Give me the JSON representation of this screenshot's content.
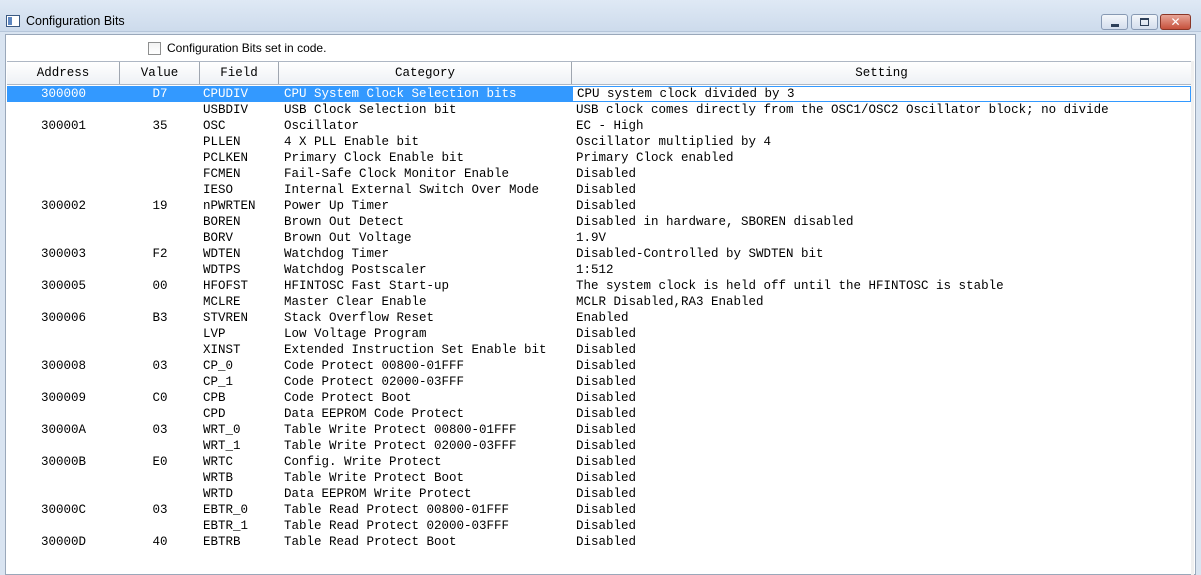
{
  "window": {
    "title": "Configuration Bits",
    "minimize_icon": "minimize-icon",
    "maximize_icon": "maximize-icon",
    "close_icon": "close-icon"
  },
  "options": {
    "checkbox_label": "Configuration Bits set in code.",
    "checked": false
  },
  "table": {
    "headers": [
      "Address",
      "Value",
      "Field",
      "Category",
      "Setting"
    ],
    "selected_row": 0,
    "rows": [
      {
        "address": "300000",
        "value": "D7",
        "field": "CPUDIV",
        "category": "CPU System Clock Selection bits",
        "setting": "CPU system clock divided by 3"
      },
      {
        "address": "",
        "value": "",
        "field": "USBDIV",
        "category": "USB Clock Selection bit",
        "setting": "USB clock comes directly from the OSC1/OSC2 Oscillator block; no divide"
      },
      {
        "address": "300001",
        "value": "35",
        "field": "OSC",
        "category": "Oscillator",
        "setting": "EC - High"
      },
      {
        "address": "",
        "value": "",
        "field": "PLLEN",
        "category": "4 X PLL Enable bit",
        "setting": "Oscillator multiplied by 4"
      },
      {
        "address": "",
        "value": "",
        "field": "PCLKEN",
        "category": "Primary Clock Enable bit",
        "setting": "Primary Clock enabled"
      },
      {
        "address": "",
        "value": "",
        "field": "FCMEN",
        "category": "Fail-Safe Clock Monitor Enable",
        "setting": "Disabled"
      },
      {
        "address": "",
        "value": "",
        "field": "IESO",
        "category": "Internal External Switch Over Mode",
        "setting": "Disabled"
      },
      {
        "address": "300002",
        "value": "19",
        "field": "nPWRTEN",
        "category": "Power Up Timer",
        "setting": "Disabled"
      },
      {
        "address": "",
        "value": "",
        "field": "BOREN",
        "category": "Brown Out Detect",
        "setting": "Disabled in hardware, SBOREN disabled"
      },
      {
        "address": "",
        "value": "",
        "field": "BORV",
        "category": "Brown Out Voltage",
        "setting": "1.9V"
      },
      {
        "address": "300003",
        "value": "F2",
        "field": "WDTEN",
        "category": "Watchdog Timer",
        "setting": "Disabled-Controlled by SWDTEN bit"
      },
      {
        "address": "",
        "value": "",
        "field": "WDTPS",
        "category": "Watchdog Postscaler",
        "setting": "1:512"
      },
      {
        "address": "300005",
        "value": "00",
        "field": "HFOFST",
        "category": "HFINTOSC Fast Start-up",
        "setting": "The system clock is held off until the HFINTOSC is stable"
      },
      {
        "address": "",
        "value": "",
        "field": "MCLRE",
        "category": "Master Clear Enable",
        "setting": "MCLR Disabled,RA3 Enabled"
      },
      {
        "address": "300006",
        "value": "B3",
        "field": "STVREN",
        "category": "Stack Overflow Reset",
        "setting": "Enabled"
      },
      {
        "address": "",
        "value": "",
        "field": "LVP",
        "category": "Low Voltage Program",
        "setting": "Disabled"
      },
      {
        "address": "",
        "value": "",
        "field": "XINST",
        "category": "Extended Instruction Set Enable bit",
        "setting": "Disabled"
      },
      {
        "address": "300008",
        "value": "03",
        "field": "CP_0",
        "category": "Code Protect 00800-01FFF",
        "setting": "Disabled"
      },
      {
        "address": "",
        "value": "",
        "field": "CP_1",
        "category": "Code Protect 02000-03FFF",
        "setting": "Disabled"
      },
      {
        "address": "300009",
        "value": "C0",
        "field": "CPB",
        "category": "Code Protect Boot",
        "setting": "Disabled"
      },
      {
        "address": "",
        "value": "",
        "field": "CPD",
        "category": "Data EEPROM Code Protect",
        "setting": "Disabled"
      },
      {
        "address": "30000A",
        "value": "03",
        "field": "WRT_0",
        "category": "Table Write Protect 00800-01FFF",
        "setting": "Disabled"
      },
      {
        "address": "",
        "value": "",
        "field": "WRT_1",
        "category": "Table Write Protect 02000-03FFF",
        "setting": "Disabled"
      },
      {
        "address": "30000B",
        "value": "E0",
        "field": "WRTC",
        "category": "Config. Write Protect",
        "setting": "Disabled"
      },
      {
        "address": "",
        "value": "",
        "field": "WRTB",
        "category": "Table Write Protect Boot",
        "setting": "Disabled"
      },
      {
        "address": "",
        "value": "",
        "field": "WRTD",
        "category": "Data EEPROM Write Protect",
        "setting": "Disabled"
      },
      {
        "address": "30000C",
        "value": "03",
        "field": "EBTR_0",
        "category": "Table Read Protect 00800-01FFF",
        "setting": "Disabled"
      },
      {
        "address": "",
        "value": "",
        "field": "EBTR_1",
        "category": "Table Read Protect 02000-03FFF",
        "setting": "Disabled"
      },
      {
        "address": "30000D",
        "value": "40",
        "field": "EBTRB",
        "category": "Table Read Protect Boot",
        "setting": "Disabled"
      }
    ]
  }
}
